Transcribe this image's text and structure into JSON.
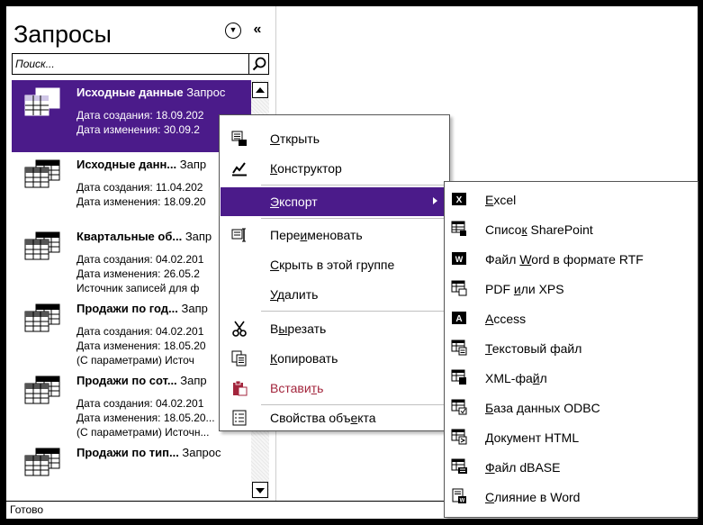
{
  "nav": {
    "title": "Запросы",
    "search_placeholder": "Поиск..."
  },
  "items": [
    {
      "name_bold": "Исходные данные",
      "name_rest": " Запрос",
      "lines": [
        "Дата создания: 18.09.202",
        "Дата изменения: 30.09.2"
      ],
      "selected": true
    },
    {
      "name_bold": "Исходные данн...",
      "name_rest": " Запр",
      "lines": [
        "Дата создания: 11.04.202",
        "Дата изменения: 18.09.20"
      ],
      "selected": false
    },
    {
      "name_bold": "Квартальные об...",
      "name_rest": " Запр",
      "lines": [
        "Дата создания: 04.02.201",
        "Дата изменения: 26.05.2",
        "Источник записей для ф"
      ],
      "selected": false
    },
    {
      "name_bold": "Продажи по год...",
      "name_rest": " Запр",
      "lines": [
        "Дата создания: 04.02.201",
        "Дата изменения: 18.05.20",
        "(С параметрами) Источ"
      ],
      "selected": false
    },
    {
      "name_bold": "Продажи по сот...",
      "name_rest": " Запр",
      "lines": [
        "Дата создания: 04.02.201",
        "Дата изменения: 18.05.20...",
        "(С параметрами) Источн..."
      ],
      "selected": false
    },
    {
      "name_bold": "Продажи по тип...",
      "name_rest": " Запрос",
      "lines": [],
      "selected": false
    }
  ],
  "status": "Готово",
  "context_menu": {
    "open": {
      "pre": "",
      "u": "О",
      "post": "ткрыть",
      "icon": "open-icon"
    },
    "design": {
      "pre": "",
      "u": "К",
      "post": "онструктор",
      "icon": "design-view-icon"
    },
    "export": {
      "pre": "",
      "u": "Э",
      "post": "кспорт",
      "icon": "none"
    },
    "rename": {
      "pre": "Пере",
      "u": "и",
      "post": "меновать",
      "icon": "rename-icon"
    },
    "hide": {
      "pre": "",
      "u": "С",
      "post": "крыть в этой группе",
      "icon": "none"
    },
    "delete": {
      "pre": "",
      "u": "У",
      "post": "далить",
      "icon": "none"
    },
    "cut": {
      "pre": "В",
      "u": "ы",
      "post": "резать",
      "icon": "scissors-icon"
    },
    "copy": {
      "pre": "",
      "u": "К",
      "post": "опировать",
      "icon": "copy-icon"
    },
    "paste": {
      "pre": "Встави",
      "u": "т",
      "post": "ь",
      "icon": "paste-icon"
    },
    "props": {
      "pre": "Свойства объ",
      "u": "е",
      "post": "кта",
      "icon": "properties-icon"
    }
  },
  "export_menu": [
    {
      "pre": "",
      "u": "E",
      "post": "xcel",
      "icon": "excel-icon"
    },
    {
      "pre": "Списо",
      "u": "к",
      "post": " SharePoint",
      "icon": "sharepoint-list-icon"
    },
    {
      "pre": "Файл ",
      "u": "W",
      "post": "ord в формате RTF",
      "icon": "word-icon"
    },
    {
      "pre": "PDF ",
      "u": "и",
      "post": "ли XPS",
      "icon": "pdf-xps-icon"
    },
    {
      "pre": "",
      "u": "A",
      "post": "ccess",
      "icon": "access-icon"
    },
    {
      "pre": "",
      "u": "Т",
      "post": "екстовый файл",
      "icon": "text-file-icon"
    },
    {
      "pre": "XML-фа",
      "u": "й",
      "post": "л",
      "icon": "xml-file-icon"
    },
    {
      "pre": "",
      "u": "Б",
      "post": "аза данных ODBC",
      "icon": "odbc-icon"
    },
    {
      "pre": "",
      "u": "Д",
      "post": "окумент HTML",
      "icon": "html-document-icon"
    },
    {
      "pre": "",
      "u": "Ф",
      "post": "айл dBASE",
      "icon": "dbase-icon"
    },
    {
      "pre": "",
      "u": "С",
      "post": "лияние в Word",
      "icon": "word-merge-icon"
    }
  ],
  "colors": {
    "selection": "#4b1b8a",
    "paste_text": "#a3253c"
  }
}
